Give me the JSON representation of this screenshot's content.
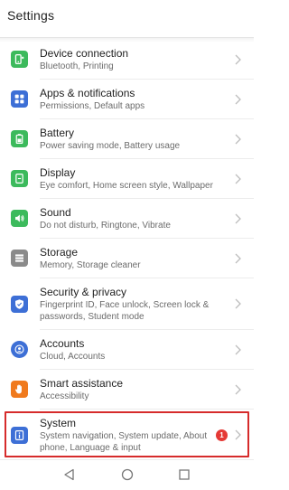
{
  "header": {
    "title": "Settings"
  },
  "items": [
    {
      "title": "Device connection",
      "subtitle": "Bluetooth, Printing",
      "icon": "device-connection-icon",
      "color": "#3cba5c"
    },
    {
      "title": "Apps & notifications",
      "subtitle": "Permissions, Default apps",
      "icon": "apps-icon",
      "color": "#3d6fd6"
    },
    {
      "title": "Battery",
      "subtitle": "Power saving mode, Battery usage",
      "icon": "battery-icon",
      "color": "#3cba5c"
    },
    {
      "title": "Display",
      "subtitle": "Eye comfort, Home screen style, Wallpaper",
      "icon": "display-icon",
      "color": "#3cba5c"
    },
    {
      "title": "Sound",
      "subtitle": "Do not disturb, Ringtone, Vibrate",
      "icon": "sound-icon",
      "color": "#3cba5c"
    },
    {
      "title": "Storage",
      "subtitle": "Memory, Storage cleaner",
      "icon": "storage-icon",
      "color": "#8a8a8a"
    },
    {
      "title": "Security & privacy",
      "subtitle": "Fingerprint ID, Face unlock, Screen lock & passwords, Student mode",
      "icon": "shield-icon",
      "color": "#3d6fd6"
    },
    {
      "title": "Accounts",
      "subtitle": "Cloud, Accounts",
      "icon": "account-icon",
      "color": "#3d6fd6"
    },
    {
      "title": "Smart assistance",
      "subtitle": "Accessibility",
      "icon": "hand-icon",
      "color": "#f07a1d"
    },
    {
      "title": "System",
      "subtitle": "System navigation, System update, About phone, Language & input",
      "icon": "system-info-icon",
      "color": "#3d6fd6",
      "badge": "1"
    }
  ],
  "navbar": {
    "back": "back-icon",
    "home": "home-icon",
    "recents": "recents-icon"
  }
}
